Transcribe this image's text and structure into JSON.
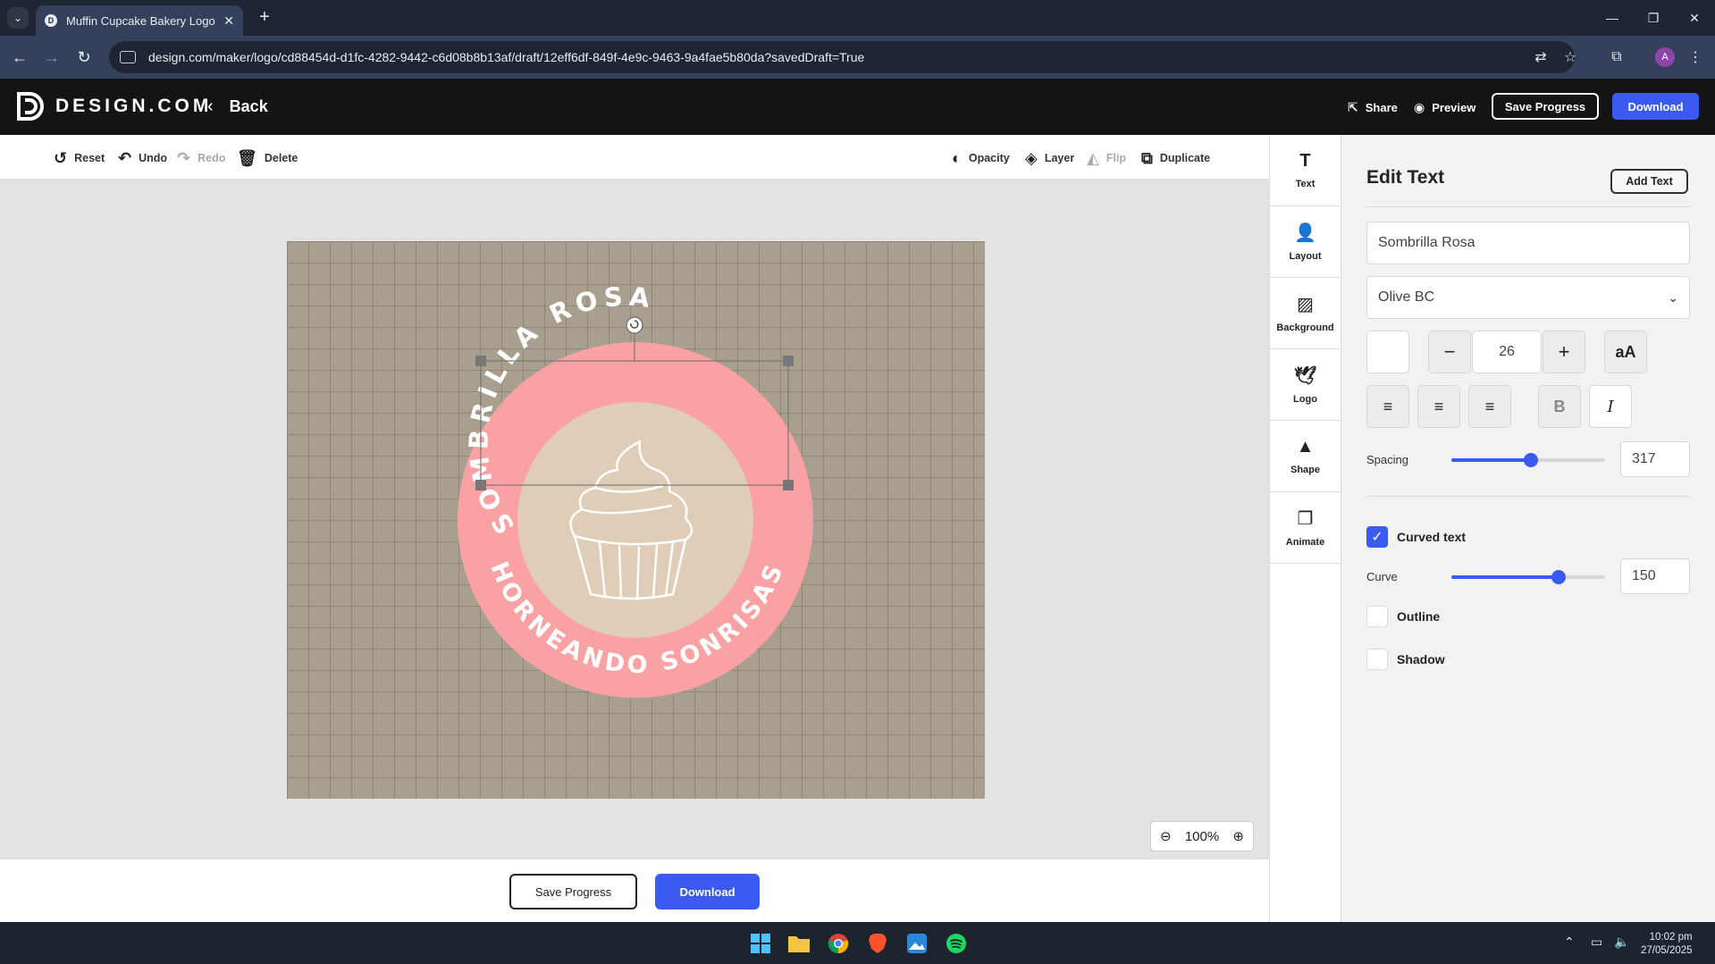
{
  "browser": {
    "tab_title": "Muffin Cupcake Bakery Logo | D",
    "url": "design.com/maker/logo/cd88454d-d1fc-4282-9442-c6d08b8b13af/draft/12eff6df-849f-4e9c-9463-9a4fae5b80da?savedDraft=True",
    "profile_initial": "A"
  },
  "header": {
    "brand": "DESIGN.COM",
    "back_label": "Back",
    "share_label": "Share",
    "preview_label": "Preview",
    "save_label": "Save Progress",
    "download_label": "Download"
  },
  "toolbar": {
    "reset": "Reset",
    "undo": "Undo",
    "redo": "Redo",
    "delete": "Delete",
    "opacity": "Opacity",
    "layer": "Layer",
    "flip": "Flip",
    "duplicate": "Duplicate"
  },
  "logo_design": {
    "top_text": "SOMBRILLA ROSA",
    "bottom_text": "HORNEANDO SONRISAS",
    "colors": {
      "ring": "#f9a1a3",
      "inner": "#dfcdb7",
      "text": "#ffffff",
      "background": "#a89f8e"
    }
  },
  "zoom": {
    "level": "100%"
  },
  "bottom": {
    "save_label": "Save Progress",
    "download_label": "Download"
  },
  "rail": [
    {
      "label": "Text",
      "icon": "text-icon"
    },
    {
      "label": "Layout",
      "icon": "layout-icon"
    },
    {
      "label": "Background",
      "icon": "background-icon"
    },
    {
      "label": "Logo",
      "icon": "logo-icon"
    },
    {
      "label": "Shape",
      "icon": "shape-icon"
    },
    {
      "label": "Animate",
      "icon": "animate-icon"
    }
  ],
  "panel": {
    "title": "Edit Text",
    "add_text_label": "Add Text",
    "text_value": "Sombrilla Rosa",
    "font": "Olive BC",
    "font_size": "26",
    "case_label": "aA",
    "spacing_label": "Spacing",
    "spacing_value": "317",
    "spacing_fraction": 0.52,
    "curved_label": "Curved text",
    "curve_label": "Curve",
    "curve_value": "150",
    "curve_fraction": 0.7,
    "outline_label": "Outline",
    "shadow_label": "Shadow"
  },
  "taskbar": {
    "time": "10:02 pm",
    "date": "27/05/2025"
  },
  "accent": "#3a5af0"
}
